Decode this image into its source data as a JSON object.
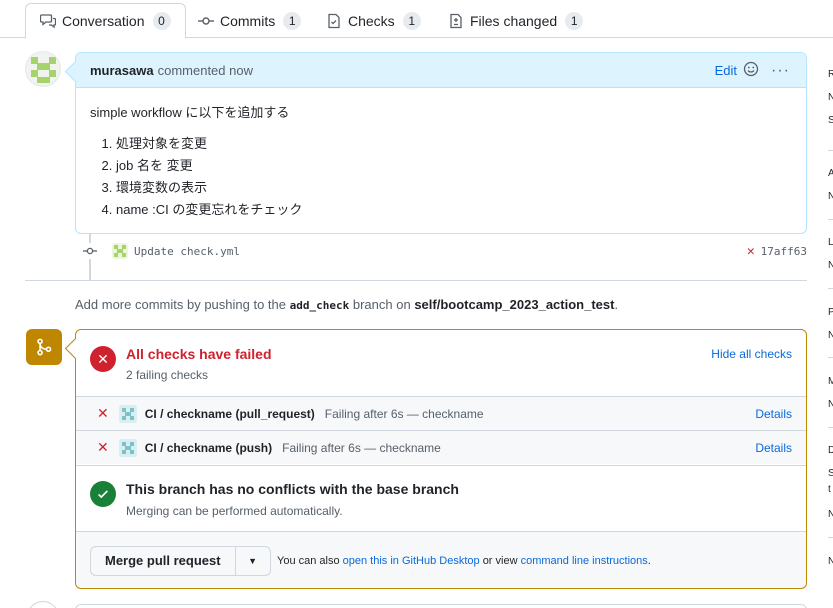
{
  "tabs": [
    {
      "label": "Conversation",
      "count": "0",
      "icon": "comment-discussion-icon"
    },
    {
      "label": "Commits",
      "count": "1",
      "icon": "git-commit-icon"
    },
    {
      "label": "Checks",
      "count": "1",
      "icon": "checklist-icon"
    },
    {
      "label": "Files changed",
      "count": "1",
      "icon": "file-diff-icon"
    }
  ],
  "comment": {
    "author": "murasawa",
    "verb": "commented now",
    "edit_label": "Edit",
    "intro": "simple workflow に以下を追加する",
    "items": [
      "処理対象を変更",
      "job 名を 変更",
      "環境変数の表示",
      "name :CI の変更忘れをチェック"
    ]
  },
  "commit": {
    "message": "Update check.yml",
    "sha": "17aff63",
    "status": "failed"
  },
  "push_hint": {
    "prefix": "Add more commits by pushing to the",
    "branch": "add_check",
    "middle": "branch on",
    "repo": "self/bootcamp_2023_action_test",
    "suffix": "."
  },
  "merge_box": {
    "checks_title": "All checks have failed",
    "checks_subtitle": "2 failing checks",
    "hide_label": "Hide all checks",
    "checks": [
      {
        "name": "CI / checkname (pull_request)",
        "desc": "Failing after 6s — checkname",
        "details": "Details"
      },
      {
        "name": "CI / checkname (push)",
        "desc": "Failing after 6s — checkname",
        "details": "Details"
      }
    ],
    "conflict_title": "This branch has no conflicts with the base branch",
    "conflict_subtitle": "Merging can be performed automatically.",
    "merge_button": "Merge pull request",
    "hint_prefix": "You can also",
    "hint_link1": "open this in GitHub Desktop",
    "hint_middle": "or view",
    "hint_link2": "command line instructions",
    "hint_suffix": "."
  },
  "sidebar_letters": [
    "R",
    "N",
    "S",
    "A",
    "N",
    "L",
    "N",
    "P",
    "N",
    "M",
    "N",
    "D",
    "S",
    "t",
    "N",
    "N"
  ],
  "colors": {
    "fail": "#cf222e",
    "success": "#1a7f37",
    "warning": "#bf8700",
    "link": "#0969da",
    "comment_header": "#ddf4ff"
  }
}
